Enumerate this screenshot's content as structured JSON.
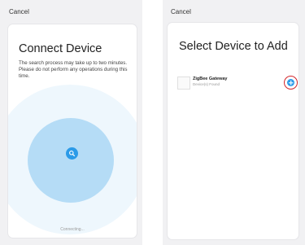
{
  "connect_screen": {
    "cancel_label": "Cancel",
    "title": "Connect Device",
    "description": "The search process may take up to two minutes. Please do not perform any operations during this time.",
    "status": "Connecting...",
    "search_icon": "search-icon"
  },
  "select_screen": {
    "cancel_label": "Cancel",
    "title": "Select Device to Add",
    "devices": [
      {
        "name": "ZigBee Gateway",
        "subtitle": "Device(s) Found",
        "action_icon": "add-icon"
      }
    ]
  },
  "colors": {
    "accent": "#2c9be8",
    "radar_inner": "#b5dcf6",
    "radar_outer": "#eef7fd",
    "highlight_ring": "#d3262b",
    "background": "#f1f1f3"
  }
}
